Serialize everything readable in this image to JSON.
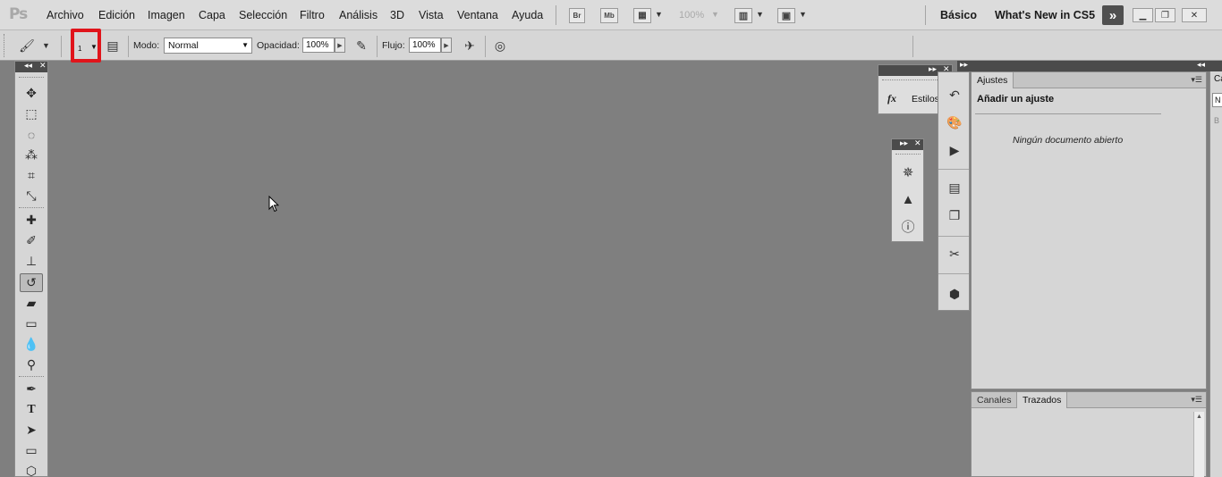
{
  "app": {
    "logo": "Ps"
  },
  "menu": [
    "Archivo",
    "Edición",
    "Imagen",
    "Capa",
    "Selección",
    "Filtro",
    "Análisis",
    "3D",
    "Vista",
    "Ventana",
    "Ayuda"
  ],
  "appbar": {
    "br": "Br",
    "mb": "Mb",
    "zoom": "100%"
  },
  "workspace": {
    "basic": "Básico",
    "whats_new": "What's New in CS5"
  },
  "options": {
    "brush_size": "1",
    "mode_label": "Modo:",
    "mode_value": "Normal",
    "opacity_label": "Opacidad:",
    "opacity_value": "100%",
    "flow_label": "Flujo:",
    "flow_value": "100%"
  },
  "styles_panel": {
    "label": "Estilos",
    "fx": "fx"
  },
  "adjustments": {
    "tab": "Ajustes",
    "title": "Añadir un ajuste",
    "empty": "Ningún documento abierto"
  },
  "paths_panel": {
    "tab_channels": "Canales",
    "tab_paths": "Trazados"
  },
  "edge_panel": {
    "tab": "Ca",
    "field": "N",
    "label": "B"
  },
  "colors": {
    "canvas": "#7f7f7f",
    "highlight": "#e0141b",
    "panel_header": "#4b4b4b"
  }
}
